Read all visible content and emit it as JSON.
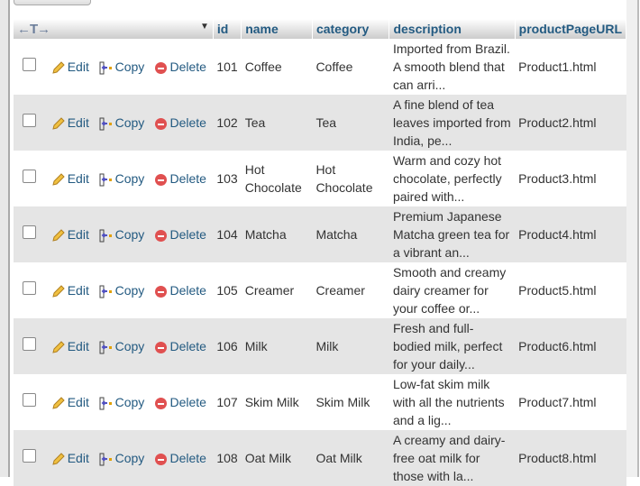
{
  "header": {
    "columns": [
      "id",
      "name",
      "category",
      "description",
      "productPageURL"
    ],
    "arrows": "←T→",
    "sort_icon": "▼"
  },
  "actions": {
    "edit": "Edit",
    "copy": "Copy",
    "delete": "Delete"
  },
  "rows": [
    {
      "id": "101",
      "name": "Coffee",
      "category": "Coffee",
      "description": "Imported from Brazil. A smooth blend that can arri...",
      "url": "Product1.html"
    },
    {
      "id": "102",
      "name": "Tea",
      "category": "Tea",
      "description": "A fine blend of tea leaves imported from India, pe...",
      "url": "Product2.html"
    },
    {
      "id": "103",
      "name": "Hot Chocolate",
      "category": "Hot Chocolate",
      "description": "Warm and cozy hot chocolate, perfectly paired with...",
      "url": "Product3.html"
    },
    {
      "id": "104",
      "name": "Matcha",
      "category": "Matcha",
      "description": "Premium Japanese Matcha green tea for a vibrant an...",
      "url": "Product4.html"
    },
    {
      "id": "105",
      "name": "Creamer",
      "category": "Creamer",
      "description": "Smooth and creamy dairy creamer for your coffee or...",
      "url": "Product5.html"
    },
    {
      "id": "106",
      "name": "Milk",
      "category": "Milk",
      "description": "Fresh and full-bodied milk, perfect for your daily...",
      "url": "Product6.html"
    },
    {
      "id": "107",
      "name": "Skim Milk",
      "category": "Skim Milk",
      "description": "Low-fat skim milk with all the nutrients and a lig...",
      "url": "Product7.html"
    },
    {
      "id": "108",
      "name": "Oat Milk",
      "category": "Oat Milk",
      "description": "A creamy and dairy-free oat milk for those with la...",
      "url": "Product8.html"
    }
  ]
}
